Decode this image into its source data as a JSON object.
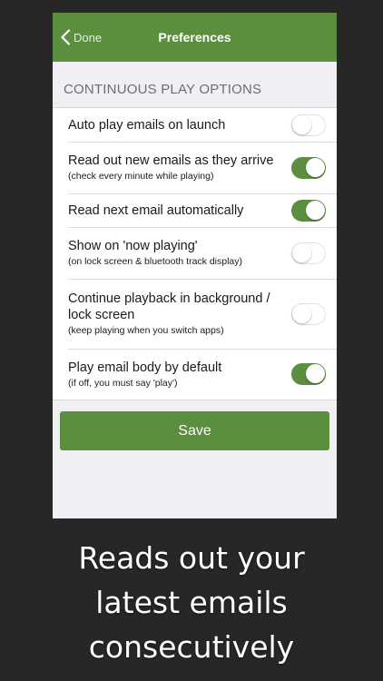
{
  "navbar": {
    "back_label": "Done",
    "title": "Preferences",
    "color": "#5b8e3f"
  },
  "section": {
    "header": "CONTINUOUS PLAY OPTIONS"
  },
  "settings": [
    {
      "label": "Auto play emails on launch",
      "sub": "",
      "on": false
    },
    {
      "label": "Read out new emails as they arrive",
      "sub": "(check every minute while playing)",
      "on": true
    },
    {
      "label": "Read next email automatically",
      "sub": "",
      "on": true
    },
    {
      "label": "Show on 'now playing'",
      "sub": "(on lock screen & bluetooth track display)",
      "on": false
    },
    {
      "label": "Continue playback in background / lock screen",
      "sub": "(keep playing when you switch apps)",
      "on": false
    },
    {
      "label": "Play email body by default",
      "sub": "(if off, you must say 'play')",
      "on": true
    }
  ],
  "save_label": "Save",
  "caption": {
    "line1": "Reads out your",
    "line2": "latest emails",
    "line3": "consecutively"
  }
}
